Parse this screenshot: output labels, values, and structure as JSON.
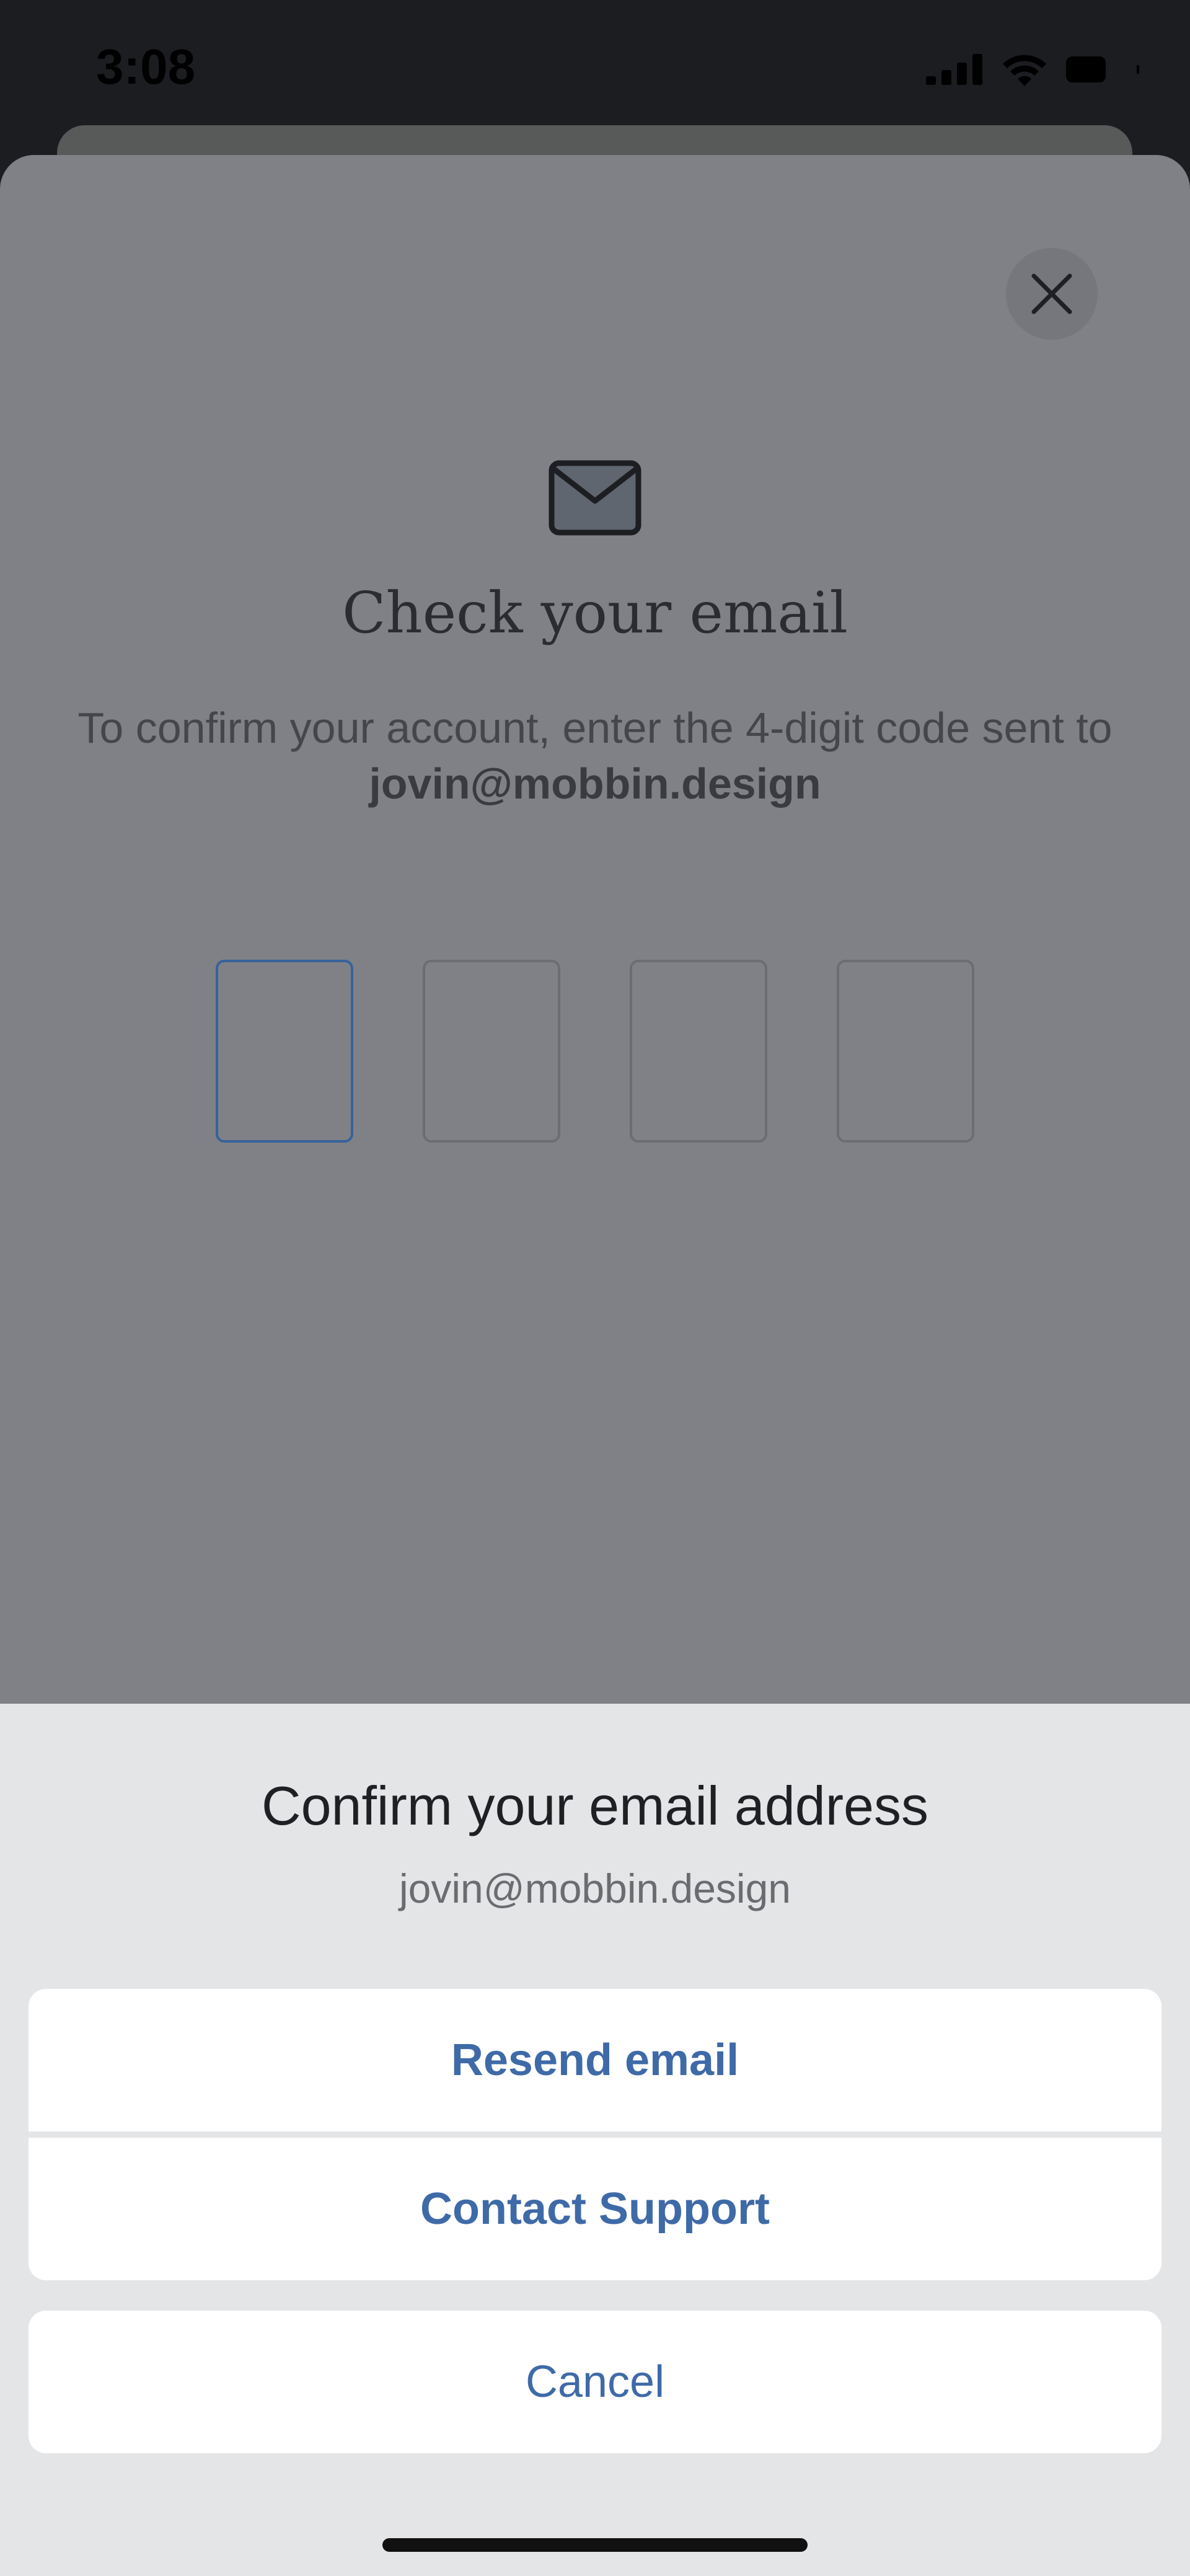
{
  "status_bar": {
    "time": "3:08"
  },
  "verify": {
    "close_icon": "close-icon",
    "mail_icon": "envelope-icon",
    "title": "Check your email",
    "description": "To confirm your account, enter the 4-digit code sent to",
    "email": "jovin@mobbin.design",
    "code_digits": [
      "",
      "",
      "",
      ""
    ]
  },
  "action_sheet": {
    "title": "Confirm your email address",
    "subtitle": "jovin@mobbin.design",
    "resend_label": "Resend email",
    "support_label": "Contact Support",
    "cancel_label": "Cancel"
  },
  "colors": {
    "accent": "#3f6aa8",
    "active_code_border": "#36629a",
    "sheet_dim": "#808186"
  }
}
